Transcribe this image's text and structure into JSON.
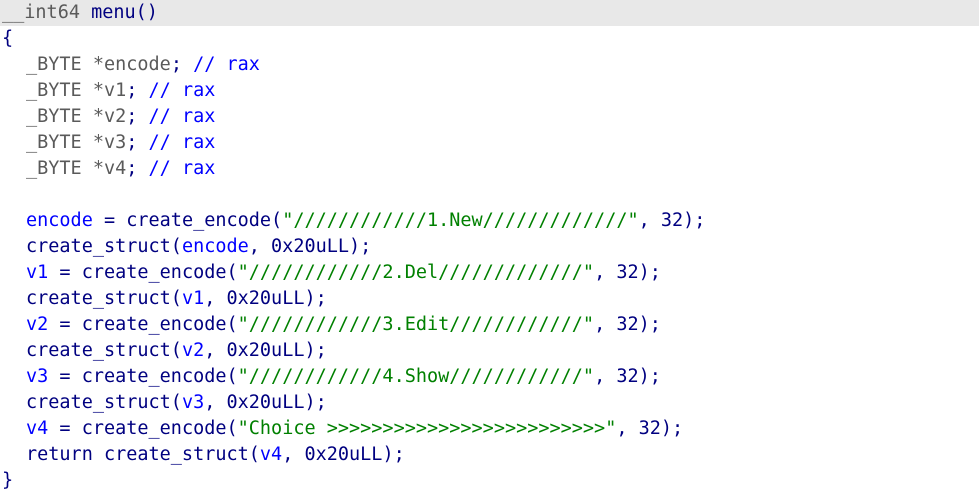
{
  "editor": {
    "header": {
      "ret_type": "__int64",
      "func_name": "menu",
      "parens": "()"
    },
    "open_brace": "{",
    "close_brace": "}",
    "decls": [
      {
        "type": "_BYTE",
        "star": "*",
        "name": "encode",
        "semi": ";",
        "comment_marker": "//",
        "comment": "rax"
      },
      {
        "type": "_BYTE",
        "star": "*",
        "name": "v1",
        "semi": ";",
        "comment_marker": "//",
        "comment": "rax"
      },
      {
        "type": "_BYTE",
        "star": "*",
        "name": "v2",
        "semi": ";",
        "comment_marker": "//",
        "comment": "rax"
      },
      {
        "type": "_BYTE",
        "star": "*",
        "name": "v3",
        "semi": ";",
        "comment_marker": "//",
        "comment": "rax"
      },
      {
        "type": "_BYTE",
        "star": "*",
        "name": "v4",
        "semi": ";",
        "comment_marker": "//",
        "comment": "rax"
      }
    ],
    "statements": [
      {
        "kind": "assign",
        "var": "encode",
        "func": "create_encode",
        "str": "\"////////////1.New/////////////\"",
        "num": "32"
      },
      {
        "kind": "call",
        "func": "create_struct",
        "var": "encode",
        "num": "0x20uLL"
      },
      {
        "kind": "assign",
        "var": "v1",
        "func": "create_encode",
        "str": "\"////////////2.Del/////////////\"",
        "num": "32"
      },
      {
        "kind": "call",
        "func": "create_struct",
        "var": "v1",
        "num": "0x20uLL"
      },
      {
        "kind": "assign",
        "var": "v2",
        "func": "create_encode",
        "str": "\"////////////3.Edit////////////\"",
        "num": "32"
      },
      {
        "kind": "call",
        "func": "create_struct",
        "var": "v2",
        "num": "0x20uLL"
      },
      {
        "kind": "assign",
        "var": "v3",
        "func": "create_encode",
        "str": "\"////////////4.Show////////////\"",
        "num": "32"
      },
      {
        "kind": "call",
        "func": "create_struct",
        "var": "v3",
        "num": "0x20uLL"
      },
      {
        "kind": "assign",
        "var": "v4",
        "func": "create_encode",
        "str": "\"Choice >>>>>>>>>>>>>>>>>>>>>>>>>\"",
        "num": "32"
      },
      {
        "kind": "return",
        "keyword": "return",
        "func": "create_struct",
        "var": "v4",
        "num": "0x20uLL"
      }
    ]
  },
  "colors": {
    "type": "#5a5a5a",
    "ident": "#000080",
    "var": "#0000ff",
    "string": "#008000",
    "header_bg": "#e8e8e8"
  }
}
